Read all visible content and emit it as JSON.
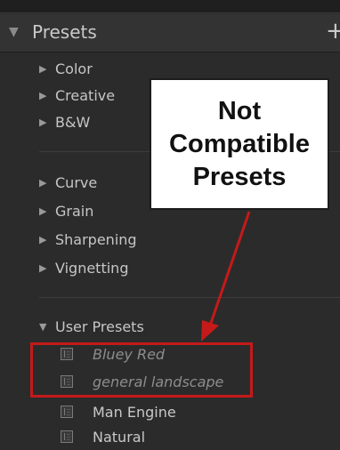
{
  "panel": {
    "title": "Presets",
    "add_label": "+"
  },
  "groups": [
    {
      "label": "Color",
      "expanded": false
    },
    {
      "label": "Creative",
      "expanded": false
    },
    {
      "label": "B&W",
      "expanded": false
    },
    {
      "label": "Curve",
      "expanded": false
    },
    {
      "label": "Grain",
      "expanded": false
    },
    {
      "label": "Sharpening",
      "expanded": false
    },
    {
      "label": "Vignetting",
      "expanded": false
    },
    {
      "label": "User Presets",
      "expanded": true
    }
  ],
  "user_presets": [
    {
      "label": "Bluey Red",
      "compatible": false
    },
    {
      "label": "general landscape",
      "compatible": false
    },
    {
      "label": "Man Engine",
      "compatible": true
    },
    {
      "label": "Natural",
      "compatible": true
    }
  ],
  "annotation": {
    "callout_text": "Not\nCompatible\nPresets",
    "highlight_color": "#c41a1a",
    "arrow_color": "#c41a1a"
  },
  "icons": {
    "collapsed": "triangle-right-icon",
    "expanded": "triangle-down-icon",
    "preset": "preset-doc-icon"
  }
}
